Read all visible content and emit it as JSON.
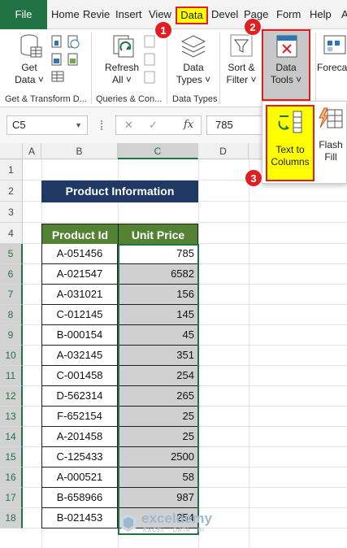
{
  "tabs": [
    "File",
    "Home",
    "Revie",
    "Insert",
    "View",
    "Data",
    "Devel",
    "Page",
    "Form",
    "Help",
    "A"
  ],
  "ribbon": {
    "groups": {
      "get_transform": "Get & Transform D...",
      "queries": "Queries & Con...",
      "data_types": "Data Types"
    },
    "get_data": [
      "Get",
      "Data ˅"
    ],
    "refresh_all": [
      "Refresh",
      "All ˅"
    ],
    "data_types_btn": [
      "Data",
      "Types ˅"
    ],
    "sort_filter": [
      "Sort &",
      "Filter ˅"
    ],
    "data_tools": [
      "Data",
      "Tools ˅"
    ],
    "forecast": "Foreca"
  },
  "popup": {
    "text_to_columns": [
      "Text to",
      "Columns"
    ],
    "flash_fill": [
      "Flash",
      "Fill"
    ]
  },
  "formula_bar": {
    "name_box": "C5",
    "fx": "fx",
    "value": "785"
  },
  "columns": [
    "A",
    "B",
    "C",
    "D"
  ],
  "rows": [
    "1",
    "2",
    "3",
    "4",
    "5",
    "6",
    "7",
    "8",
    "9",
    "10",
    "11",
    "12",
    "13",
    "14",
    "15",
    "16",
    "17",
    "18"
  ],
  "table": {
    "title": "Product Information",
    "headers": [
      "Product Id",
      "Unit Price"
    ],
    "ids": [
      "A-051456",
      "A-021547",
      "A-031021",
      "C-012145",
      "B-000154",
      "A-032145",
      "C-001458",
      "D-562314",
      "F-652154",
      "A-201458",
      "C-125433",
      "A-000521",
      "B-658966",
      "B-021453"
    ],
    "prices": [
      "785",
      "6582",
      "156",
      "145",
      "45",
      "351",
      "254",
      "265",
      "25",
      "25",
      "2500",
      "58",
      "987",
      "254"
    ]
  },
  "badges": [
    "1",
    "2",
    "3"
  ],
  "watermark": [
    "exceldemy",
    "EXCEL · DATA · BI"
  ],
  "colors": {
    "excel_green": "#217346",
    "title_fill": "#1f3864",
    "header_fill": "#548235",
    "highlight": "#ffff00",
    "badge": "#e02020"
  }
}
